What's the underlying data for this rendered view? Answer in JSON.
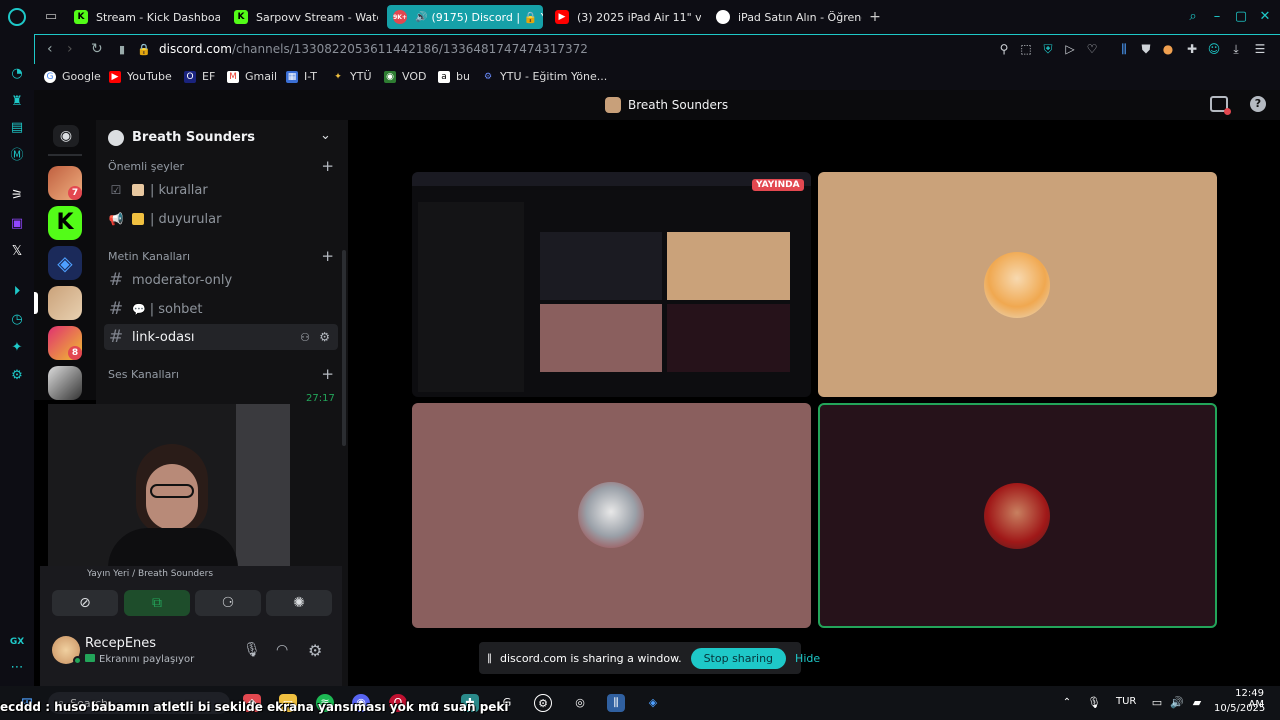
{
  "browser": {
    "tabs": [
      {
        "label": "Stream - Kick Dashboard",
        "active": false
      },
      {
        "label": "Sarpovv Stream - Watch",
        "active": false
      },
      {
        "label": "(9175) Discord | 🔒 Y",
        "active": true,
        "badge": "9K+"
      },
      {
        "label": "(3) 2025 iPad Air 11\" vs 1",
        "active": false
      },
      {
        "label": "iPad Satın Alın - Öğrenci",
        "active": false
      }
    ],
    "new_tab": "+",
    "url_host": "discord.com",
    "url_path": "/channels/1330822053611442186/1336481747474317372",
    "bookmarks": [
      "Google",
      "YouTube",
      "EF",
      "Gmail",
      "I-T",
      "YTÜ",
      "VOD",
      "bu",
      "YTU - Eğitim Yöne..."
    ],
    "sidebar_label": "GX"
  },
  "discord": {
    "window_title": "Breath Sounders",
    "server_name": "Breath Sounders",
    "server_badges": [
      "7",
      "8"
    ],
    "sections": {
      "important": "Önemli şeyler",
      "text": "Metin Kanalları",
      "voice": "Ses Kanalları"
    },
    "channels_important": [
      "| kurallar",
      "| duyurular"
    ],
    "channels_text": [
      "moderator-only",
      "| sohbet",
      "link-odası"
    ],
    "voice_timer": "27:17",
    "live_label": "YAYINDA",
    "voice_status_location": "Yayın Yeri / Breath Sounders",
    "user": {
      "name": "RecepEnes",
      "status": "Ekranını paylaşıyor"
    },
    "share_bar": {
      "message": "discord.com is sharing a window.",
      "stop_label": "Stop sharing",
      "hide_label": "Hide"
    },
    "tile_colors": {
      "tan": "#caa27a",
      "rose": "#8a5f5e",
      "maroon": "#26121a",
      "speaking_border": "#23a55a"
    }
  },
  "taskbar": {
    "search_placeholder": "Search",
    "language": "TUR",
    "time": "12:49 AM",
    "date": "10/5/2025"
  },
  "overlay_caption": "ecddd : huso babamın atletli bi sekilde ekrana yansıması yok mu suan peki"
}
